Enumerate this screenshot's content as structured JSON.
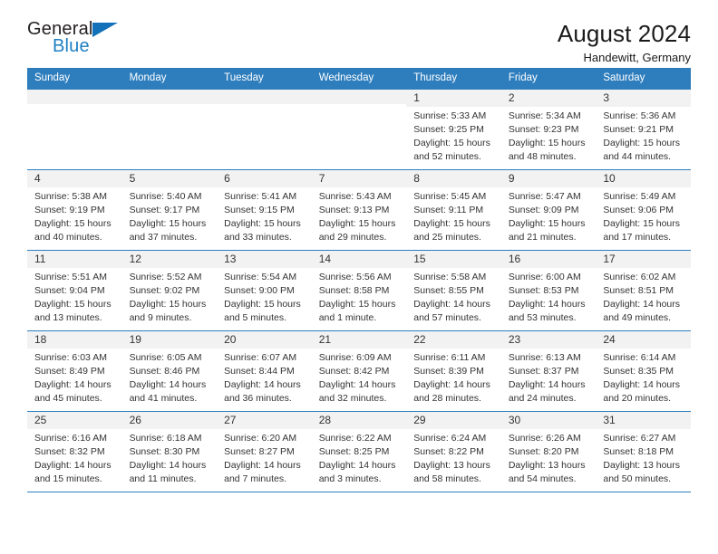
{
  "brand": {
    "name_part1": "General",
    "name_part2": "Blue",
    "triangle_color": "#1271b8",
    "blue_color": "#1f7fc4"
  },
  "header": {
    "title": "August 2024",
    "subtitle": "Handewitt, Germany"
  },
  "theme": {
    "header_bg": "#2e7ebe",
    "date_band_bg": "#f2f2f2",
    "row_divider": "#2e7ebe",
    "text": "#333333"
  },
  "weekday_headers": [
    "Sunday",
    "Monday",
    "Tuesday",
    "Wednesday",
    "Thursday",
    "Friday",
    "Saturday"
  ],
  "weeks": [
    [
      {
        "date": "",
        "sunrise": "",
        "sunset": "",
        "daylight_line1": "",
        "daylight_line2": ""
      },
      {
        "date": "",
        "sunrise": "",
        "sunset": "",
        "daylight_line1": "",
        "daylight_line2": ""
      },
      {
        "date": "",
        "sunrise": "",
        "sunset": "",
        "daylight_line1": "",
        "daylight_line2": ""
      },
      {
        "date": "",
        "sunrise": "",
        "sunset": "",
        "daylight_line1": "",
        "daylight_line2": ""
      },
      {
        "date": "1",
        "sunrise": "Sunrise: 5:33 AM",
        "sunset": "Sunset: 9:25 PM",
        "daylight_line1": "Daylight: 15 hours",
        "daylight_line2": "and 52 minutes."
      },
      {
        "date": "2",
        "sunrise": "Sunrise: 5:34 AM",
        "sunset": "Sunset: 9:23 PM",
        "daylight_line1": "Daylight: 15 hours",
        "daylight_line2": "and 48 minutes."
      },
      {
        "date": "3",
        "sunrise": "Sunrise: 5:36 AM",
        "sunset": "Sunset: 9:21 PM",
        "daylight_line1": "Daylight: 15 hours",
        "daylight_line2": "and 44 minutes."
      }
    ],
    [
      {
        "date": "4",
        "sunrise": "Sunrise: 5:38 AM",
        "sunset": "Sunset: 9:19 PM",
        "daylight_line1": "Daylight: 15 hours",
        "daylight_line2": "and 40 minutes."
      },
      {
        "date": "5",
        "sunrise": "Sunrise: 5:40 AM",
        "sunset": "Sunset: 9:17 PM",
        "daylight_line1": "Daylight: 15 hours",
        "daylight_line2": "and 37 minutes."
      },
      {
        "date": "6",
        "sunrise": "Sunrise: 5:41 AM",
        "sunset": "Sunset: 9:15 PM",
        "daylight_line1": "Daylight: 15 hours",
        "daylight_line2": "and 33 minutes."
      },
      {
        "date": "7",
        "sunrise": "Sunrise: 5:43 AM",
        "sunset": "Sunset: 9:13 PM",
        "daylight_line1": "Daylight: 15 hours",
        "daylight_line2": "and 29 minutes."
      },
      {
        "date": "8",
        "sunrise": "Sunrise: 5:45 AM",
        "sunset": "Sunset: 9:11 PM",
        "daylight_line1": "Daylight: 15 hours",
        "daylight_line2": "and 25 minutes."
      },
      {
        "date": "9",
        "sunrise": "Sunrise: 5:47 AM",
        "sunset": "Sunset: 9:09 PM",
        "daylight_line1": "Daylight: 15 hours",
        "daylight_line2": "and 21 minutes."
      },
      {
        "date": "10",
        "sunrise": "Sunrise: 5:49 AM",
        "sunset": "Sunset: 9:06 PM",
        "daylight_line1": "Daylight: 15 hours",
        "daylight_line2": "and 17 minutes."
      }
    ],
    [
      {
        "date": "11",
        "sunrise": "Sunrise: 5:51 AM",
        "sunset": "Sunset: 9:04 PM",
        "daylight_line1": "Daylight: 15 hours",
        "daylight_line2": "and 13 minutes."
      },
      {
        "date": "12",
        "sunrise": "Sunrise: 5:52 AM",
        "sunset": "Sunset: 9:02 PM",
        "daylight_line1": "Daylight: 15 hours",
        "daylight_line2": "and 9 minutes."
      },
      {
        "date": "13",
        "sunrise": "Sunrise: 5:54 AM",
        "sunset": "Sunset: 9:00 PM",
        "daylight_line1": "Daylight: 15 hours",
        "daylight_line2": "and 5 minutes."
      },
      {
        "date": "14",
        "sunrise": "Sunrise: 5:56 AM",
        "sunset": "Sunset: 8:58 PM",
        "daylight_line1": "Daylight: 15 hours",
        "daylight_line2": "and 1 minute."
      },
      {
        "date": "15",
        "sunrise": "Sunrise: 5:58 AM",
        "sunset": "Sunset: 8:55 PM",
        "daylight_line1": "Daylight: 14 hours",
        "daylight_line2": "and 57 minutes."
      },
      {
        "date": "16",
        "sunrise": "Sunrise: 6:00 AM",
        "sunset": "Sunset: 8:53 PM",
        "daylight_line1": "Daylight: 14 hours",
        "daylight_line2": "and 53 minutes."
      },
      {
        "date": "17",
        "sunrise": "Sunrise: 6:02 AM",
        "sunset": "Sunset: 8:51 PM",
        "daylight_line1": "Daylight: 14 hours",
        "daylight_line2": "and 49 minutes."
      }
    ],
    [
      {
        "date": "18",
        "sunrise": "Sunrise: 6:03 AM",
        "sunset": "Sunset: 8:49 PM",
        "daylight_line1": "Daylight: 14 hours",
        "daylight_line2": "and 45 minutes."
      },
      {
        "date": "19",
        "sunrise": "Sunrise: 6:05 AM",
        "sunset": "Sunset: 8:46 PM",
        "daylight_line1": "Daylight: 14 hours",
        "daylight_line2": "and 41 minutes."
      },
      {
        "date": "20",
        "sunrise": "Sunrise: 6:07 AM",
        "sunset": "Sunset: 8:44 PM",
        "daylight_line1": "Daylight: 14 hours",
        "daylight_line2": "and 36 minutes."
      },
      {
        "date": "21",
        "sunrise": "Sunrise: 6:09 AM",
        "sunset": "Sunset: 8:42 PM",
        "daylight_line1": "Daylight: 14 hours",
        "daylight_line2": "and 32 minutes."
      },
      {
        "date": "22",
        "sunrise": "Sunrise: 6:11 AM",
        "sunset": "Sunset: 8:39 PM",
        "daylight_line1": "Daylight: 14 hours",
        "daylight_line2": "and 28 minutes."
      },
      {
        "date": "23",
        "sunrise": "Sunrise: 6:13 AM",
        "sunset": "Sunset: 8:37 PM",
        "daylight_line1": "Daylight: 14 hours",
        "daylight_line2": "and 24 minutes."
      },
      {
        "date": "24",
        "sunrise": "Sunrise: 6:14 AM",
        "sunset": "Sunset: 8:35 PM",
        "daylight_line1": "Daylight: 14 hours",
        "daylight_line2": "and 20 minutes."
      }
    ],
    [
      {
        "date": "25",
        "sunrise": "Sunrise: 6:16 AM",
        "sunset": "Sunset: 8:32 PM",
        "daylight_line1": "Daylight: 14 hours",
        "daylight_line2": "and 15 minutes."
      },
      {
        "date": "26",
        "sunrise": "Sunrise: 6:18 AM",
        "sunset": "Sunset: 8:30 PM",
        "daylight_line1": "Daylight: 14 hours",
        "daylight_line2": "and 11 minutes."
      },
      {
        "date": "27",
        "sunrise": "Sunrise: 6:20 AM",
        "sunset": "Sunset: 8:27 PM",
        "daylight_line1": "Daylight: 14 hours",
        "daylight_line2": "and 7 minutes."
      },
      {
        "date": "28",
        "sunrise": "Sunrise: 6:22 AM",
        "sunset": "Sunset: 8:25 PM",
        "daylight_line1": "Daylight: 14 hours",
        "daylight_line2": "and 3 minutes."
      },
      {
        "date": "29",
        "sunrise": "Sunrise: 6:24 AM",
        "sunset": "Sunset: 8:22 PM",
        "daylight_line1": "Daylight: 13 hours",
        "daylight_line2": "and 58 minutes."
      },
      {
        "date": "30",
        "sunrise": "Sunrise: 6:26 AM",
        "sunset": "Sunset: 8:20 PM",
        "daylight_line1": "Daylight: 13 hours",
        "daylight_line2": "and 54 minutes."
      },
      {
        "date": "31",
        "sunrise": "Sunrise: 6:27 AM",
        "sunset": "Sunset: 8:18 PM",
        "daylight_line1": "Daylight: 13 hours",
        "daylight_line2": "and 50 minutes."
      }
    ]
  ]
}
